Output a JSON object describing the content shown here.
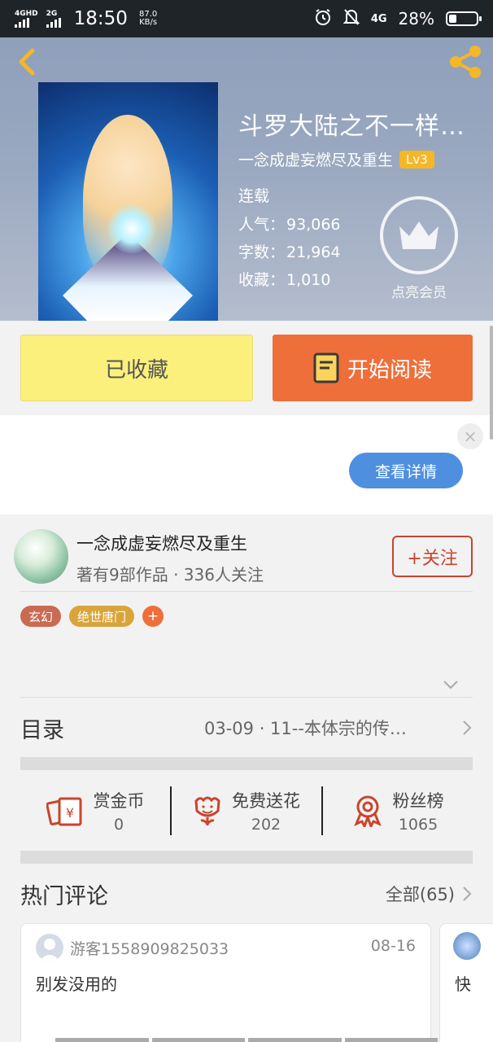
{
  "status_bar": {
    "signal1_label": "4GHD",
    "signal2_label": "2G",
    "time": "18:50",
    "net_speed_value": "87.0",
    "net_speed_unit": "KB/s",
    "network_label": "4G",
    "battery": "28%",
    "battery_level": 0.28
  },
  "book": {
    "title": "斗罗大陆之不一样的…",
    "author": "一念成虚妄燃尽及重生",
    "level": "Lv3",
    "status": "连载",
    "popularity_label": "人气：",
    "popularity": "93,066",
    "word_count_label": "字数：",
    "word_count": "21,964",
    "collections_label": "收藏：",
    "collections": "1,010",
    "vip_label": "点亮会员"
  },
  "actions": {
    "collected_label": "已收藏",
    "read_label": "开始阅读"
  },
  "ad": {
    "close_label": "×",
    "detail_label": "查看详情"
  },
  "author_card": {
    "name": "一念成虚妄燃尽及重生",
    "info": "著有9部作品 · 336人关注",
    "follow_label": "+关注"
  },
  "tags": [
    {
      "label": "玄幻",
      "color": "#c96a52"
    },
    {
      "label": "绝世唐门",
      "color": "#d9a53a"
    }
  ],
  "tag_add_label": "+",
  "catalog": {
    "label": "目录",
    "latest": "03-09 · 11--本体宗的传…"
  },
  "stats": [
    {
      "label": "赏金币",
      "value": "0",
      "icon": "reward-coin-icon"
    },
    {
      "label": "免费送花",
      "value": "202",
      "icon": "flower-icon"
    },
    {
      "label": "粉丝榜",
      "value": "1065",
      "icon": "medal-icon"
    }
  ],
  "comments": {
    "title": "热门评论",
    "all_label": "全部(65)",
    "items": [
      {
        "user": "游客1558909825033",
        "date": "08-16",
        "text": "别发没用的"
      },
      {
        "text": "快"
      }
    ]
  },
  "colors": {
    "accent_orange": "#ee6f3a",
    "collected_yellow": "#fbf07c",
    "follow_red": "#c9452d",
    "detail_blue": "#4f8fe0",
    "level_gold": "#f5b727"
  }
}
